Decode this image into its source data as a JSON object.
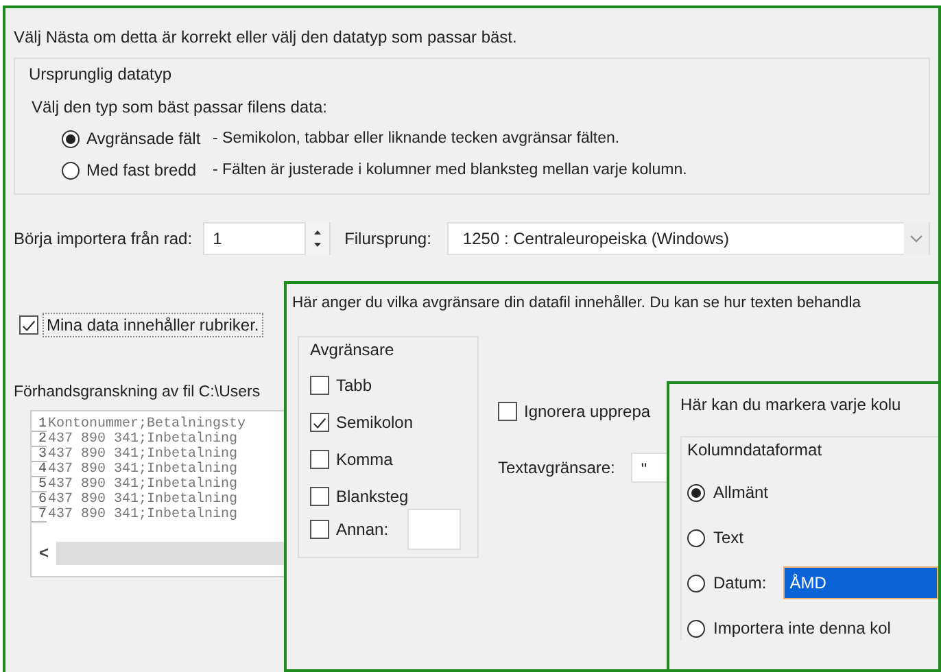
{
  "import_dialog": {
    "intro": "Välj Nästa om detta är korrekt eller välj den datatyp som passar bäst.",
    "original_type": {
      "title": "Ursprunglig datatyp",
      "prompt": "Välj den typ som bäst passar filens data:",
      "options": [
        {
          "label": "Avgränsade fält",
          "description": "- Semikolon, tabbar eller liknande tecken avgränsar fälten.",
          "selected": true
        },
        {
          "label": "Med fast bredd",
          "description": "- Fälten är justerade i kolumner med blanksteg mellan varje kolumn.",
          "selected": false
        }
      ]
    },
    "start_row": {
      "label": "Börja importera från rad:",
      "value": "1"
    },
    "file_origin": {
      "label": "Filursprung:",
      "value": "1250 : Centraleuropeiska (Windows)"
    },
    "has_headers": {
      "label": "Mina data innehåller rubriker.",
      "checked": true
    },
    "preview": {
      "title": "Förhandsgranskning av fil C:\\Users",
      "lines": [
        {
          "number": "1",
          "text": "Kontonummer;Betalningsty"
        },
        {
          "number": "2",
          "text": "437 890 341;Inbetalning"
        },
        {
          "number": "3",
          "text": "437 890 341;Inbetalning"
        },
        {
          "number": "4",
          "text": "437 890 341;Inbetalning"
        },
        {
          "number": "5",
          "text": "437 890 341;Inbetalning"
        },
        {
          "number": "6",
          "text": "437 890 341;Inbetalning"
        },
        {
          "number": "7",
          "text": "437 890 341;Inbetalning"
        }
      ],
      "scroll_left": "<"
    }
  },
  "delimiters_dialog": {
    "intro": "Här anger du vilka avgränsare din datafil innehåller. Du kan se hur texten behandla",
    "group_title": "Avgränsare",
    "delimiters": [
      {
        "label": "Tabb",
        "checked": false,
        "kind": "plain"
      },
      {
        "label": "Semikolon",
        "checked": true,
        "kind": "plain"
      },
      {
        "label": "Komma",
        "checked": false,
        "kind": "plain"
      },
      {
        "label": "Blanksteg",
        "checked": false,
        "kind": "plain"
      },
      {
        "label": "Annan:",
        "checked": false,
        "kind": "other"
      }
    ],
    "consecutive": {
      "label": "Ignorera upprepa",
      "checked": false
    },
    "text_qualifier": {
      "label": "Textavgränsare:",
      "value": "\""
    }
  },
  "format_dialog": {
    "intro": "Här kan du markera varje kolu",
    "group_title": "Kolumndataformat",
    "formats": [
      {
        "label": "Allmänt",
        "selected": true
      },
      {
        "label": "Text",
        "selected": false
      },
      {
        "label": "Datum:",
        "selected": false,
        "value": "ÅMD"
      },
      {
        "label": "Importera inte denna kol",
        "selected": false
      }
    ]
  }
}
